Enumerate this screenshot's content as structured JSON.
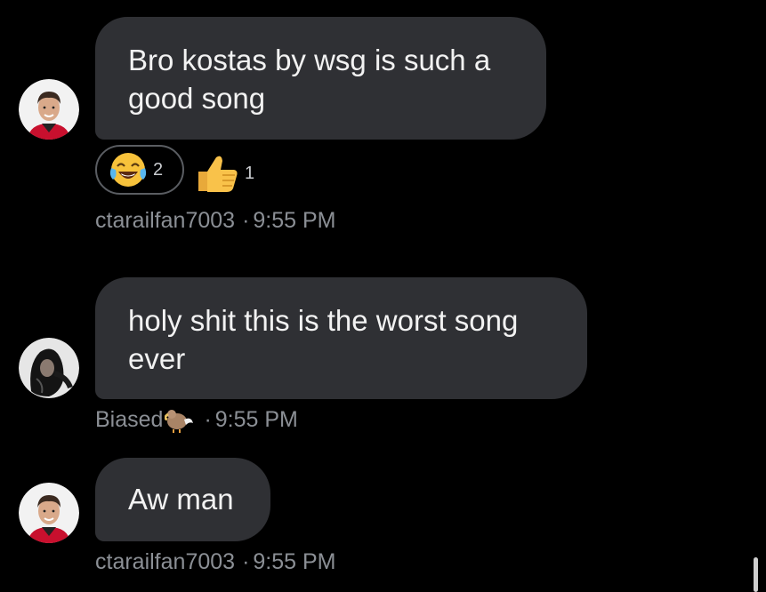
{
  "messages": [
    {
      "text": "Bro kostas by wsg is such a good song",
      "author": "ctarailfan7003",
      "time": "9:55 PM",
      "reactions": [
        {
          "emoji": "laughing-crying-emoji",
          "count": "2"
        },
        {
          "emoji": "thumbs-up-emoji",
          "count": "1"
        }
      ]
    },
    {
      "text": "holy shit this is the worst song ever",
      "author": "Biased",
      "author_emoji": "dodo-emoji",
      "time": "9:55 PM"
    },
    {
      "text": "Aw man",
      "author": "ctarailfan7003",
      "time": "9:55 PM"
    }
  ],
  "separator": "·",
  "colors": {
    "background": "#000000",
    "bubble": "#2f3034",
    "meta_text": "#8b8f95"
  }
}
